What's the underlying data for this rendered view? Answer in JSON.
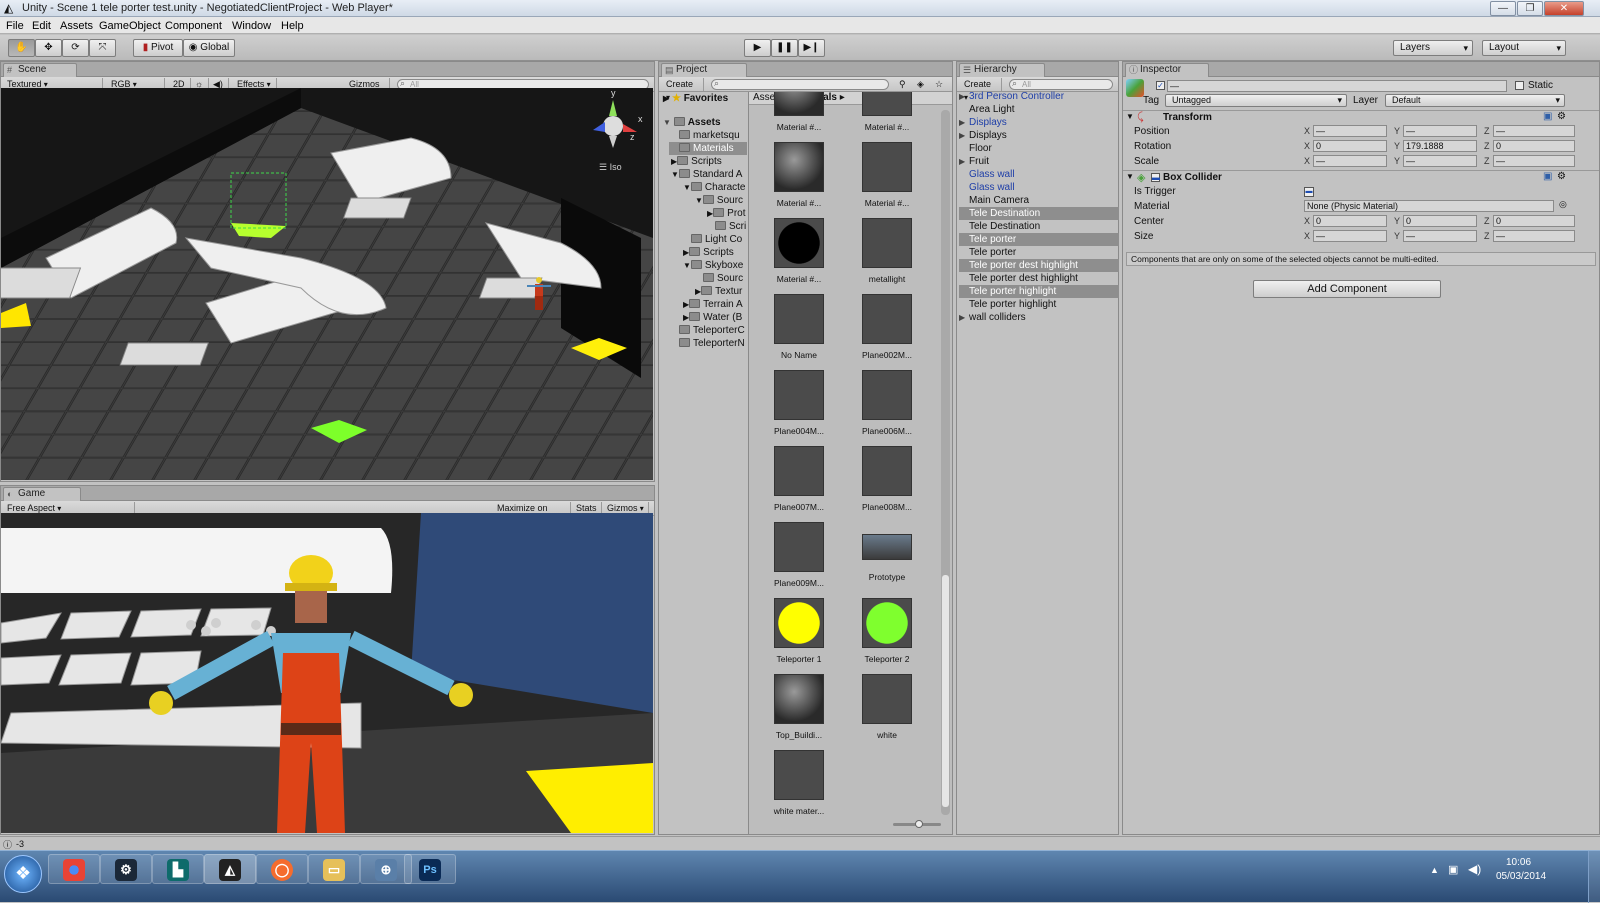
{
  "window": {
    "title": "Unity - Scene 1 tele porter test.unity - NegotiatedClientProject - Web Player*",
    "minimize": "—",
    "maximize": "❐",
    "close": "✕"
  },
  "menu": [
    "File",
    "Edit",
    "Assets",
    "GameObject",
    "Component",
    "Window",
    "Help"
  ],
  "toolbar": {
    "pivot": "Pivot",
    "global": "Global",
    "layers": "Layers",
    "layout": "Layout"
  },
  "scene": {
    "tab": "Scene",
    "shading": "Textured",
    "rgb": "RGB",
    "mode2d": "2D",
    "effects": "Effects",
    "gizmos": "Gizmos",
    "search_placeholder": "All",
    "iso": "Iso",
    "axis": {
      "y": "y",
      "x": "x",
      "z": "z"
    }
  },
  "game": {
    "tab": "Game",
    "aspect": "Free Aspect",
    "maximize": "Maximize on Play",
    "stats": "Stats",
    "gizmos": "Gizmos"
  },
  "project": {
    "tab": "Project",
    "create": "Create",
    "favorites": "Favorites",
    "tree": [
      {
        "label": "Assets",
        "bold": true
      },
      {
        "label": "marketsqu"
      },
      {
        "label": "Materials",
        "selected": true
      },
      {
        "label": "Scripts"
      },
      {
        "label": "Standard A"
      },
      {
        "label": "Characte"
      },
      {
        "label": "Sourc"
      },
      {
        "label": "Prot"
      },
      {
        "label": "Scri"
      },
      {
        "label": "Light Co"
      },
      {
        "label": "Scripts"
      },
      {
        "label": "Skyboxe"
      },
      {
        "label": "Sourc"
      },
      {
        "label": "Textur"
      },
      {
        "label": "Terrain A"
      },
      {
        "label": "Water (B"
      },
      {
        "label": "TeleporterC"
      },
      {
        "label": "TeleporterN"
      }
    ],
    "breadcrumb": [
      "Assets",
      "Materials"
    ],
    "materials": [
      {
        "name": "Material #...",
        "kind": "sphere-gray"
      },
      {
        "name": "Material #...",
        "kind": "square"
      },
      {
        "name": "Material #...",
        "kind": "sphere-gray"
      },
      {
        "name": "Material #...",
        "kind": "square"
      },
      {
        "name": "Material #...",
        "kind": "sphere-black"
      },
      {
        "name": "metallight",
        "kind": "square"
      },
      {
        "name": "No Name",
        "kind": "square"
      },
      {
        "name": "Plane002M...",
        "kind": "square"
      },
      {
        "name": "Plane004M...",
        "kind": "square"
      },
      {
        "name": "Plane006M...",
        "kind": "square"
      },
      {
        "name": "Plane007M...",
        "kind": "square"
      },
      {
        "name": "Plane008M...",
        "kind": "square"
      },
      {
        "name": "Plane009M...",
        "kind": "square"
      },
      {
        "name": "Prototype",
        "kind": "image"
      },
      {
        "name": "Teleporter 1",
        "kind": "sphere-yellow"
      },
      {
        "name": "Teleporter 2",
        "kind": "sphere-green"
      },
      {
        "name": "Top_Buildi...",
        "kind": "sphere-gray"
      },
      {
        "name": "white",
        "kind": "square"
      },
      {
        "name": "white mater...",
        "kind": "square"
      }
    ]
  },
  "hierarchy": {
    "tab": "Hierarchy",
    "create": "Create",
    "search_placeholder": "All",
    "items": [
      {
        "label": "3rd Person Controller",
        "blue": true,
        "arrow": true
      },
      {
        "label": "Area Light"
      },
      {
        "label": "Displays",
        "blue": true,
        "arrow": true
      },
      {
        "label": "Displays",
        "arrow": true
      },
      {
        "label": "Floor"
      },
      {
        "label": "Fruit",
        "arrow": true
      },
      {
        "label": "Glass wall",
        "blue": true
      },
      {
        "label": "Glass wall",
        "blue": true
      },
      {
        "label": "Main Camera"
      },
      {
        "label": "Tele Destination",
        "selected": true
      },
      {
        "label": "Tele Destination"
      },
      {
        "label": "Tele porter",
        "selected": true
      },
      {
        "label": "Tele porter"
      },
      {
        "label": "Tele porter dest highlight",
        "selected": true
      },
      {
        "label": "Tele porter dest highlight"
      },
      {
        "label": "Tele porter highlight",
        "selected": true
      },
      {
        "label": "Tele porter highlight"
      },
      {
        "label": "wall colliders",
        "arrow": true
      }
    ]
  },
  "inspector": {
    "tab": "Inspector",
    "name_value": "—",
    "static_label": "Static",
    "tag_label": "Tag",
    "tag_value": "Untagged",
    "layer_label": "Layer",
    "layer_value": "Default",
    "transform": {
      "title": "Transform",
      "position_label": "Position",
      "rotation_label": "Rotation",
      "scale_label": "Scale",
      "position": [
        "—",
        "—",
        "—"
      ],
      "rotation": [
        "0",
        "179.1888",
        "0"
      ],
      "scale": [
        "—",
        "—",
        "—"
      ]
    },
    "collider": {
      "title": "Box Collider",
      "is_trigger_label": "Is Trigger",
      "material_label": "Material",
      "material_value": "None (Physic Material)",
      "center_label": "Center",
      "center": [
        "0",
        "0",
        "0"
      ],
      "size_label": "Size",
      "size": [
        "—",
        "—",
        "—"
      ]
    },
    "axis": [
      "X",
      "Y",
      "Z"
    ],
    "note": "Components that are only on some of the selected objects cannot be multi-edited.",
    "add_component": "Add Component"
  },
  "status": {
    "text": "-3"
  },
  "taskbar": {
    "time": "10:06",
    "date": "05/03/2014"
  }
}
